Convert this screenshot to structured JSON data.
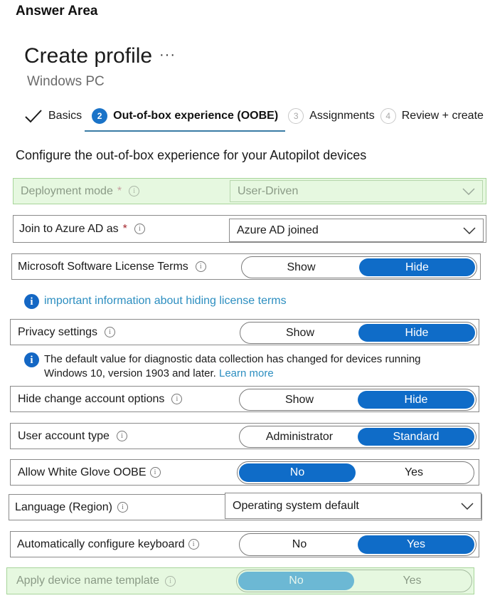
{
  "answer_area": "Answer Area",
  "header": {
    "title": "Create profile",
    "more": "···",
    "subtitle": "Windows PC"
  },
  "wizard": {
    "steps": [
      {
        "label": "Basics",
        "state": "done"
      },
      {
        "num": "2",
        "label": "Out-of-box experience (OOBE)",
        "state": "active"
      },
      {
        "num": "3",
        "label": "Assignments",
        "state": "inactive"
      },
      {
        "num": "4",
        "label": "Review + create",
        "state": "inactive"
      }
    ]
  },
  "section_heading": "Configure the out-of-box experience for your Autopilot devices",
  "fields": {
    "deployment_mode": {
      "label": "Deployment mode",
      "required": "*",
      "value": "User-Driven",
      "highlighted": true
    },
    "join_azure": {
      "label": "Join to Azure AD as",
      "required": "*",
      "value": "Azure AD joined"
    },
    "license_terms": {
      "label": "Microsoft Software License Terms",
      "options": [
        "Show",
        "Hide"
      ],
      "selected": "Hide"
    },
    "license_notice": {
      "link": "important information about hiding license terms"
    },
    "privacy": {
      "label": "Privacy settings",
      "options": [
        "Show",
        "Hide"
      ],
      "selected": "Hide"
    },
    "privacy_notice": {
      "text": "The default value for diagnostic data collection has changed for devices running",
      "text2": "Windows 10, version 1903 and later.",
      "link": "Learn more"
    },
    "hide_change_account": {
      "label": "Hide change account options",
      "options": [
        "Show",
        "Hide"
      ],
      "selected": "Hide"
    },
    "user_account_type": {
      "label": "User account type",
      "options": [
        "Administrator",
        "Standard"
      ],
      "selected": "Standard"
    },
    "white_glove": {
      "label": "Allow White Glove OOBE",
      "options": [
        "No",
        "Yes"
      ],
      "selected": "No"
    },
    "language": {
      "label": "Language (Region)",
      "value": "Operating system default"
    },
    "auto_keyboard": {
      "label": "Automatically configure keyboard",
      "options": [
        "No",
        "Yes"
      ],
      "selected": "Yes"
    },
    "device_name_template": {
      "label": "Apply device name template",
      "options": [
        "No",
        "Yes"
      ],
      "selected": "No",
      "highlighted": true
    }
  },
  "colors": {
    "accent": "#0f6cc8",
    "highlight_bg": "#e6f8e0",
    "link": "#2c8ec0",
    "required": "#a4262c"
  }
}
